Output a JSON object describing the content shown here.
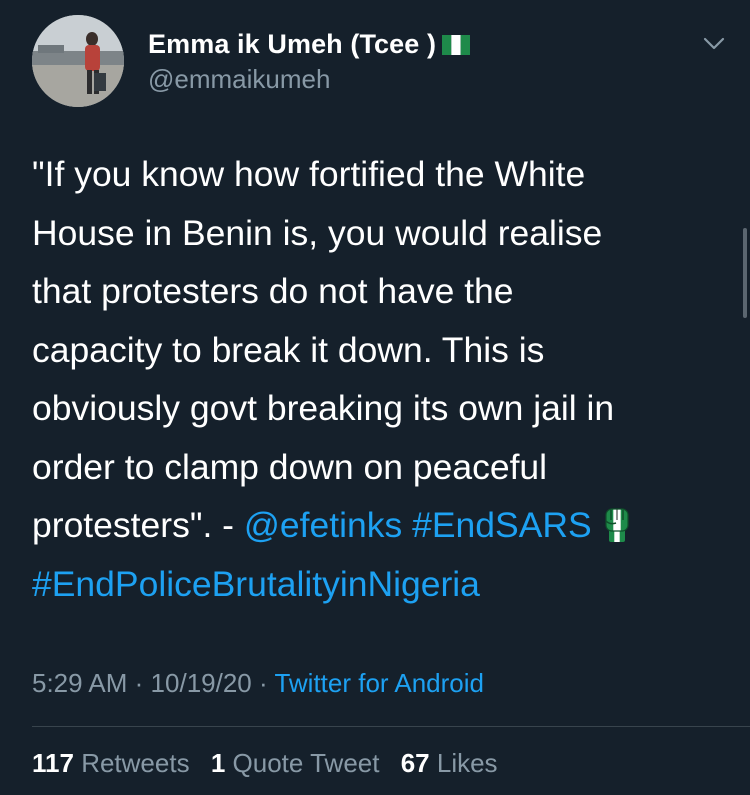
{
  "user": {
    "display_name": "Emma ik Umeh (Tcee )",
    "handle": "@emmaikumeh",
    "flag_icon": "nigeria-flag-icon",
    "avatar_icon": "user-avatar"
  },
  "tweet": {
    "lines": [
      "\"If you know how fortified the White",
      "House in Benin is, you would realise",
      "that protesters do not have the",
      "capacity to break it down. This is",
      "obviously govt breaking its own jail in",
      "order to clamp down on peaceful"
    ],
    "line7_prefix": "protesters\". - ",
    "mention": "@efetinks",
    "hashtag_1": "#EndSARS",
    "hashtag_2": "#EndPoliceBrutalityinNigeria",
    "emoji_icon": "raised-fist-nigeria-icon"
  },
  "meta": {
    "time": "5:29 AM",
    "date": "10/19/20",
    "separator": "·",
    "source": "Twitter for Android"
  },
  "stats": {
    "retweets_count": "117",
    "retweets_label": "Retweets",
    "quotes_count": "1",
    "quotes_label": "Quote Tweet",
    "likes_count": "67",
    "likes_label": "Likes"
  },
  "colors": {
    "background": "#15202b",
    "primary_text": "#ffffff",
    "secondary_text": "#8899a6",
    "link": "#1da1f2",
    "divider": "#38444d"
  }
}
